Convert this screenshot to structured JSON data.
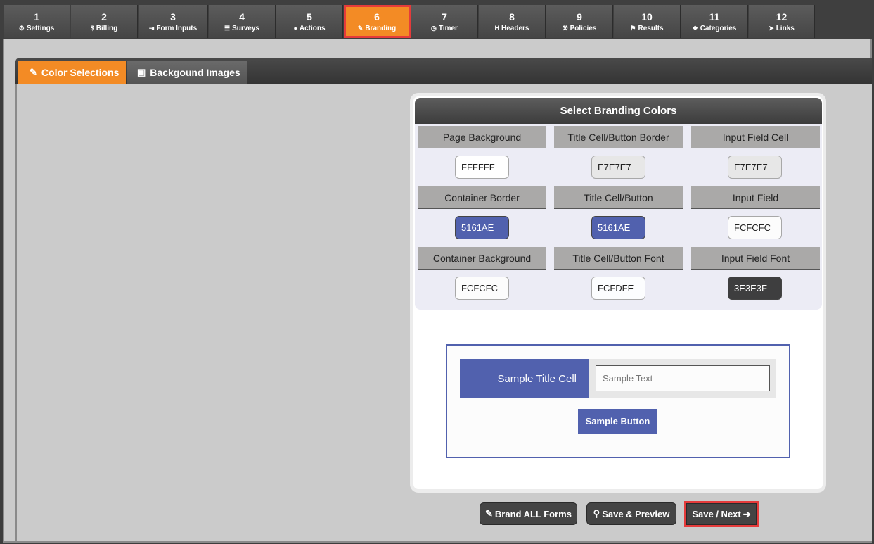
{
  "steps": [
    {
      "num": "1",
      "label": "Settings",
      "icon": "gear-icon",
      "glyph": "⚙"
    },
    {
      "num": "2",
      "label": "Billing",
      "icon": "dollar-icon",
      "glyph": "$"
    },
    {
      "num": "3",
      "label": "Form Inputs",
      "icon": "sign-in-icon",
      "glyph": "⇥"
    },
    {
      "num": "4",
      "label": "Surveys",
      "icon": "list-icon",
      "glyph": "☰"
    },
    {
      "num": "5",
      "label": "Actions",
      "icon": "user-icon",
      "glyph": "●"
    },
    {
      "num": "6",
      "label": "Branding",
      "icon": "brush-icon",
      "glyph": "✎"
    },
    {
      "num": "7",
      "label": "Timer",
      "icon": "clock-icon",
      "glyph": "◷"
    },
    {
      "num": "8",
      "label": "Headers",
      "icon": "header-icon",
      "glyph": "H"
    },
    {
      "num": "9",
      "label": "Policies",
      "icon": "gavel-icon",
      "glyph": "⚒"
    },
    {
      "num": "10",
      "label": "Results",
      "icon": "flag-icon",
      "glyph": "⚑"
    },
    {
      "num": "11",
      "label": "Categories",
      "icon": "cubes-icon",
      "glyph": "❖"
    },
    {
      "num": "12",
      "label": "Links",
      "icon": "pointer-icon",
      "glyph": "➤"
    }
  ],
  "active_step": "6",
  "tabs": {
    "color_selections": "Color Selections",
    "background_images": "Backgound Images"
  },
  "panel": {
    "title": "Select Branding Colors",
    "fields": [
      {
        "label": "Page Background",
        "value": "FFFFFF",
        "color": "#FFFFFF",
        "text": "#222222"
      },
      {
        "label": "Title Cell/Button Border",
        "value": "E7E7E7",
        "color": "#E7E7E7",
        "text": "#222222"
      },
      {
        "label": "Input Field Cell",
        "value": "E7E7E7",
        "color": "#E7E7E7",
        "text": "#222222"
      },
      {
        "label": "Container Border",
        "value": "5161AE",
        "color": "#5161AE",
        "text": "#FFFFFF"
      },
      {
        "label": "Title Cell/Button",
        "value": "5161AE",
        "color": "#5161AE",
        "text": "#FFFFFF"
      },
      {
        "label": "Input Field",
        "value": "FCFCFC",
        "color": "#FCFCFC",
        "text": "#222222"
      },
      {
        "label": "Container Background",
        "value": "FCFCFC",
        "color": "#FCFCFC",
        "text": "#222222"
      },
      {
        "label": "Title Cell/Button Font",
        "value": "FCFDFE",
        "color": "#FCFDFE",
        "text": "#222222"
      },
      {
        "label": "Input Field Font",
        "value": "3E3E3F",
        "color": "#3E3E3F",
        "text": "#FFFFFF"
      }
    ]
  },
  "sample": {
    "title_cell": "Sample Title Cell",
    "input_placeholder": "Sample Text",
    "button": "Sample Button"
  },
  "buttons": {
    "brand_all": "Brand ALL Forms",
    "save_preview": "Save & Preview",
    "save_next": "Save / Next"
  },
  "colors": {
    "accent": "#F38B25",
    "highlight": "#E53B3B",
    "brand": "#5161AE"
  }
}
